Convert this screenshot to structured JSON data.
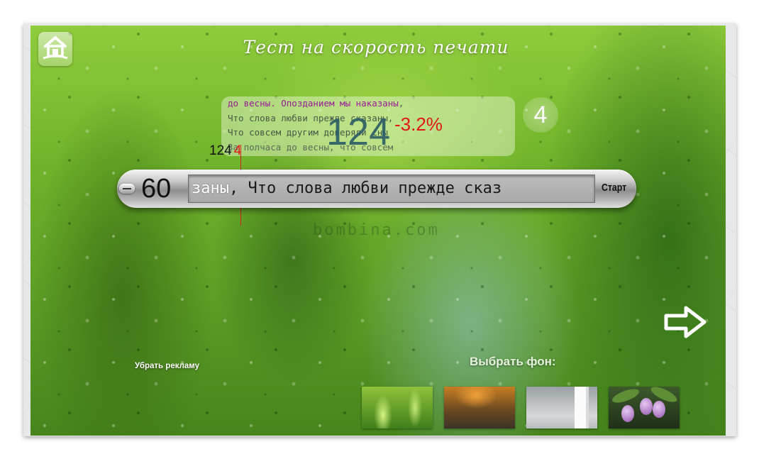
{
  "app": {
    "title": "Тест на скорость печати",
    "watermark": "bombina.com"
  },
  "passage": {
    "typed_line": "до весны. Опозданием мы наказаны",
    "typed_line_tail": ",",
    "line2": "Что слова любви прежде сказаны,",
    "line3": "Что совсем другим доверяли сны",
    "line4": "За полчаса до весны, что совсем"
  },
  "stats": {
    "speed": "124",
    "speed_delta": "-3.2%",
    "errors": "4",
    "mini_speed": "124",
    "mini_errors": "4"
  },
  "typing_bar": {
    "timer": "60",
    "typed_text": "заны",
    "upcoming_text": ", Что слова любви прежде сказ",
    "start_label": "Старт"
  },
  "footer": {
    "remove_ads": "Убрать рекламу",
    "choose_background": "Выбрать фон:"
  },
  "backgrounds": [
    {
      "name": "grass"
    },
    {
      "name": "sunset"
    },
    {
      "name": "door"
    },
    {
      "name": "plums"
    }
  ],
  "icons": {
    "home": "home-icon",
    "next": "arrow-right-icon",
    "minus": "minus-icon"
  },
  "colors": {
    "typed_passage": "#9b1a9b",
    "error_red": "#e01818",
    "speed_teal": "#2d5f66"
  }
}
